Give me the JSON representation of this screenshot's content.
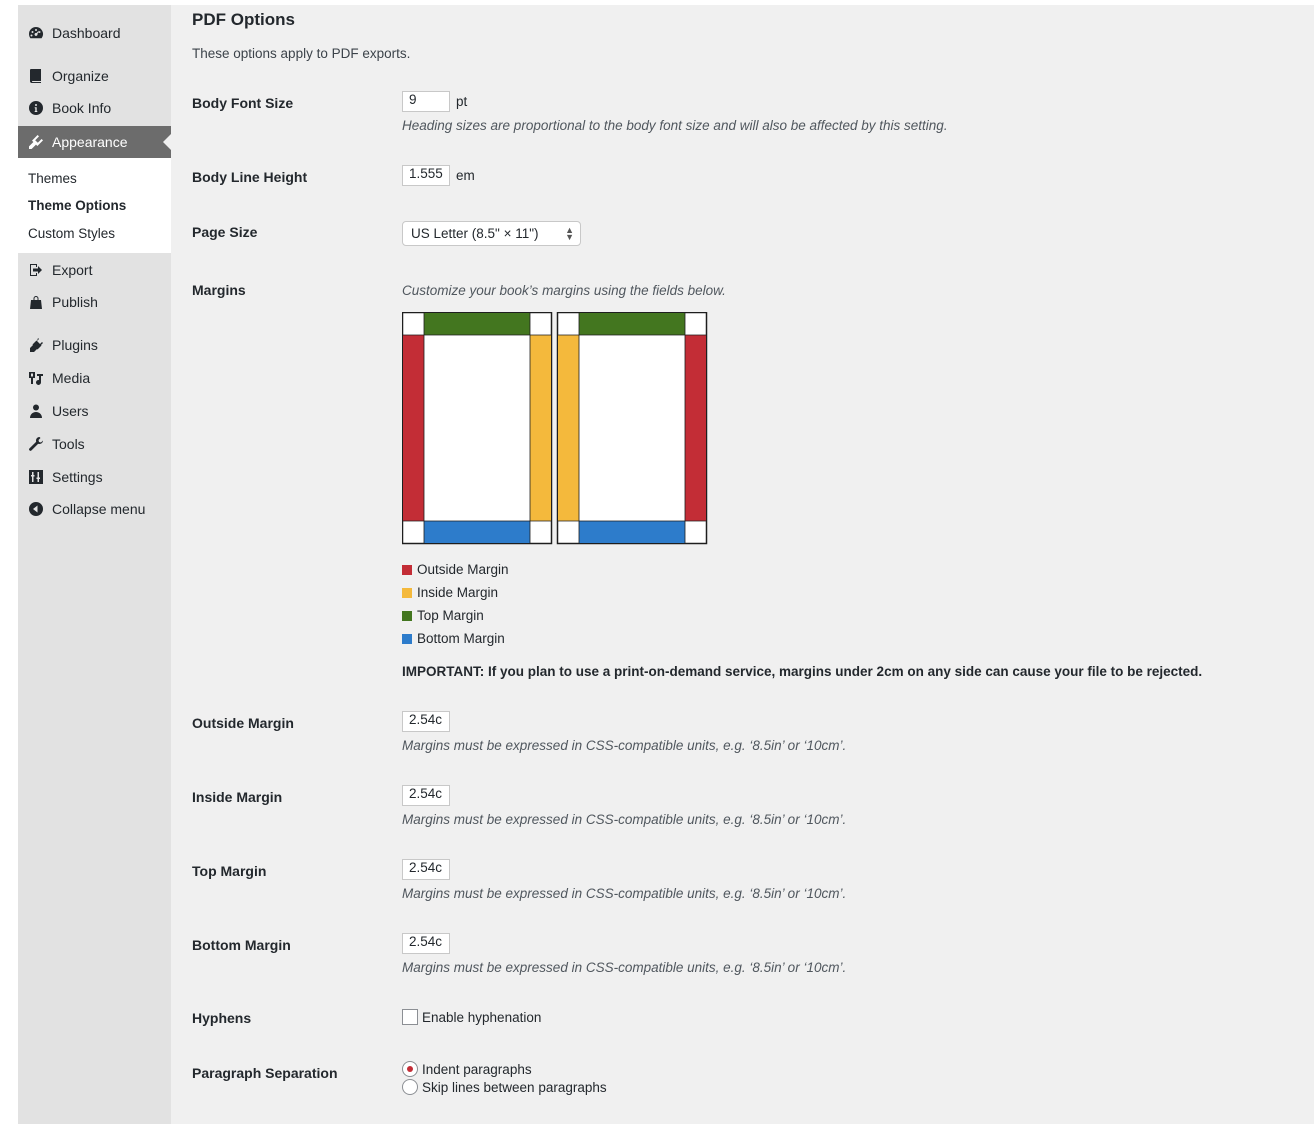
{
  "sidebar": {
    "items": [
      {
        "label": "Dashboard",
        "icon": "dashboard-icon"
      },
      {
        "label": "Organize",
        "icon": "book-icon"
      },
      {
        "label": "Book Info",
        "icon": "info-icon"
      },
      {
        "label": "Appearance",
        "icon": "brush-icon",
        "active": true
      },
      {
        "label": "Export",
        "icon": "export-icon"
      },
      {
        "label": "Publish",
        "icon": "store-icon"
      },
      {
        "label": "Plugins",
        "icon": "plugin-icon"
      },
      {
        "label": "Media",
        "icon": "media-icon"
      },
      {
        "label": "Users",
        "icon": "users-icon"
      },
      {
        "label": "Tools",
        "icon": "wrench-icon"
      },
      {
        "label": "Settings",
        "icon": "settings-icon"
      },
      {
        "label": "Collapse menu",
        "icon": "collapse-icon"
      }
    ],
    "submenu": [
      {
        "label": "Themes"
      },
      {
        "label": "Theme Options",
        "current": true
      },
      {
        "label": "Custom Styles"
      }
    ]
  },
  "main": {
    "title": "PDF Options",
    "intro": "These options apply to PDF exports.",
    "body_font_size": {
      "label": "Body Font Size",
      "value": "9",
      "unit": "pt",
      "description": "Heading sizes are proportional to the body font size and will also be affected by this setting."
    },
    "body_line_height": {
      "label": "Body Line Height",
      "value": "1.555",
      "unit": "em"
    },
    "page_size": {
      "label": "Page Size",
      "selected": "US Letter (8.5\" × 11\")"
    },
    "margins": {
      "label": "Margins",
      "description": "Customize your book’s margins using the fields below.",
      "legend": [
        {
          "label": "Outside Margin",
          "color": "#c32d36"
        },
        {
          "label": "Inside Margin",
          "color": "#f4b93c"
        },
        {
          "label": "Top Margin",
          "color": "#43761f"
        },
        {
          "label": "Bottom Margin",
          "color": "#2d7ccb"
        }
      ],
      "important": "IMPORTANT: If you plan to use a print-on-demand service, margins under 2cm on any side can cause your file to be rejected."
    },
    "margin_fields": [
      {
        "label": "Outside Margin",
        "value": "2.54c",
        "description": "Margins must be expressed in CSS-compatible units, e.g. ‘8.5in’ or ‘10cm’."
      },
      {
        "label": "Inside Margin",
        "value": "2.54c",
        "description": "Margins must be expressed in CSS-compatible units, e.g. ‘8.5in’ or ‘10cm’."
      },
      {
        "label": "Top Margin",
        "value": "2.54c",
        "description": "Margins must be expressed in CSS-compatible units, e.g. ‘8.5in’ or ‘10cm’."
      },
      {
        "label": "Bottom Margin",
        "value": "2.54c",
        "description": "Margins must be expressed in CSS-compatible units, e.g. ‘8.5in’ or ‘10cm’."
      }
    ],
    "hyphens": {
      "label": "Hyphens",
      "option": "Enable hyphenation",
      "checked": false
    },
    "paragraph_separation": {
      "label": "Paragraph Separation",
      "options": [
        {
          "label": "Indent paragraphs",
          "selected": true
        },
        {
          "label": "Skip lines between paragraphs",
          "selected": false
        }
      ]
    }
  }
}
